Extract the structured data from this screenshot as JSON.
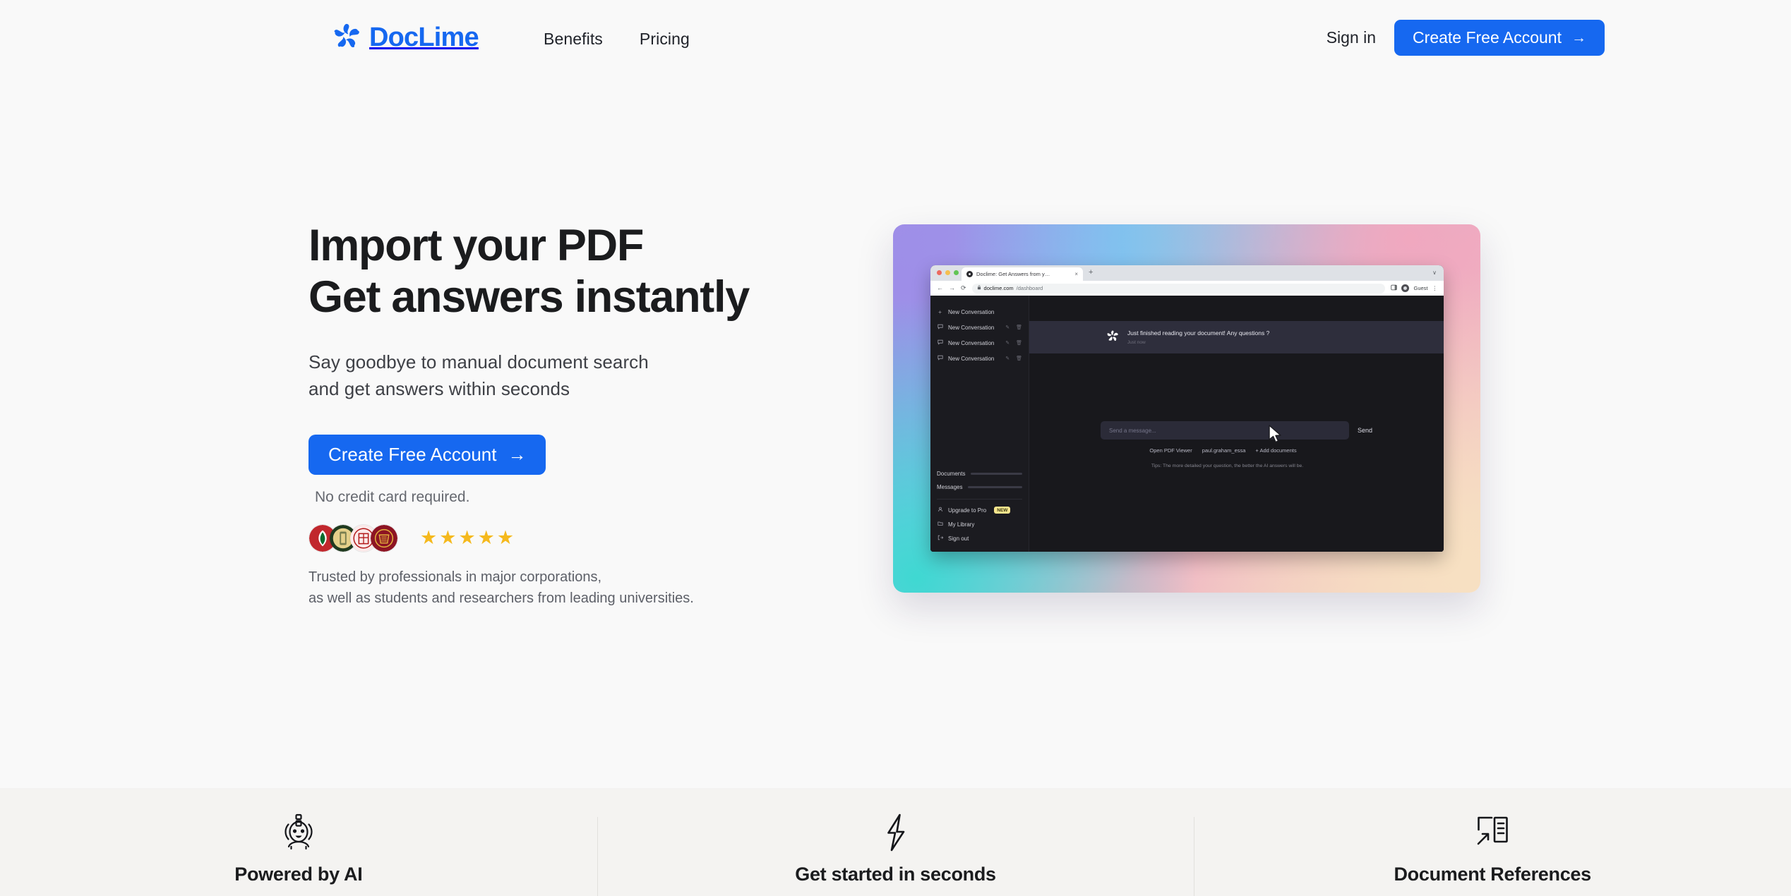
{
  "nav": {
    "brand": "DocLime",
    "logo_icon": "doclime-spiral-logo",
    "links": [
      {
        "label": "Benefits"
      },
      {
        "label": "Pricing"
      }
    ],
    "signin_label": "Sign in",
    "cta_label": "Create Free Account",
    "cta_arrow": "→"
  },
  "hero": {
    "title_line1": "Import your PDF",
    "title_line2": "Get answers instantly",
    "subtitle_line1": "Say goodbye to manual document search",
    "subtitle_line2": "and get answers within seconds",
    "cta_label": "Create Free Account",
    "cta_arrow": "→",
    "note": "No credit card required.",
    "stars": [
      "★",
      "★",
      "★",
      "★",
      "★"
    ],
    "star_color": "#f5b91d",
    "seals": [
      {
        "name": "stanford-seal",
        "bg": "#c1272d",
        "fg": "#ffffff"
      },
      {
        "name": "university-seal-green-gold",
        "bg": "#1f3a1f",
        "fg": "#d9c06a"
      },
      {
        "name": "cornell-seal",
        "bg": "#fbeaea",
        "fg": "#b31b1b"
      },
      {
        "name": "harvard-seal",
        "bg": "#8d1423",
        "fg": "#e3b23c"
      }
    ],
    "trust_line1": "Trusted by professionals in major corporations,",
    "trust_line2": "as well as students and researchers from leading universities."
  },
  "mockup": {
    "browser": {
      "tab_title": "Doclime: Get Answers from y…",
      "tab_close": "×",
      "new_tab": "+",
      "chevron": "∨",
      "back": "←",
      "forward": "→",
      "reload": "⟳",
      "lock": "🔒",
      "url_domain": "doclime.com",
      "url_path": "/dashboard",
      "profile_label": "Guest",
      "menu": "⋮"
    },
    "sidebar": {
      "new_conversation_label": "New Conversation",
      "new_icon": "+",
      "conversations": [
        {
          "label": "New Conversation"
        },
        {
          "label": "New Conversation"
        },
        {
          "label": "New Conversation"
        }
      ],
      "conv_icon": "💬",
      "edit_icon": "✎",
      "delete_icon": "🗑",
      "meters": [
        {
          "label": "Documents"
        },
        {
          "label": "Messages"
        }
      ],
      "menu": [
        {
          "label": "Upgrade to Pro",
          "icon": "user-icon",
          "badge": "NEW"
        },
        {
          "label": "My Library",
          "icon": "folder-icon",
          "badge": ""
        },
        {
          "label": "Sign out",
          "icon": "signout-icon",
          "badge": ""
        }
      ]
    },
    "chat": {
      "message": "Just finished reading your document! Any questions ?",
      "timestamp": "Just now",
      "avatar_icon": "doclime-spiral-logo"
    },
    "composer": {
      "placeholder": "Send a message...",
      "send_label": "Send",
      "open_pdf_label": "Open PDF Viewer",
      "document_name": "paul.graham_essa",
      "add_documents_label": "Add documents",
      "add_icon": "+",
      "tip": "Tips: The more detailed your question, the better the AI answers will be."
    }
  },
  "features": [
    {
      "label": "Powered by AI",
      "icon": "robot-icon"
    },
    {
      "label": "Get started in seconds",
      "icon": "lightning-bolt-icon"
    },
    {
      "label": "Document References",
      "icon": "document-reference-icon"
    }
  ],
  "colors": {
    "brand_blue": "#1668f0",
    "hero_bg": "#f9f9f9",
    "lower_bg": "#f4f3f1",
    "star_gold": "#f5b91d",
    "badge_yellow": "#f6e58d"
  }
}
